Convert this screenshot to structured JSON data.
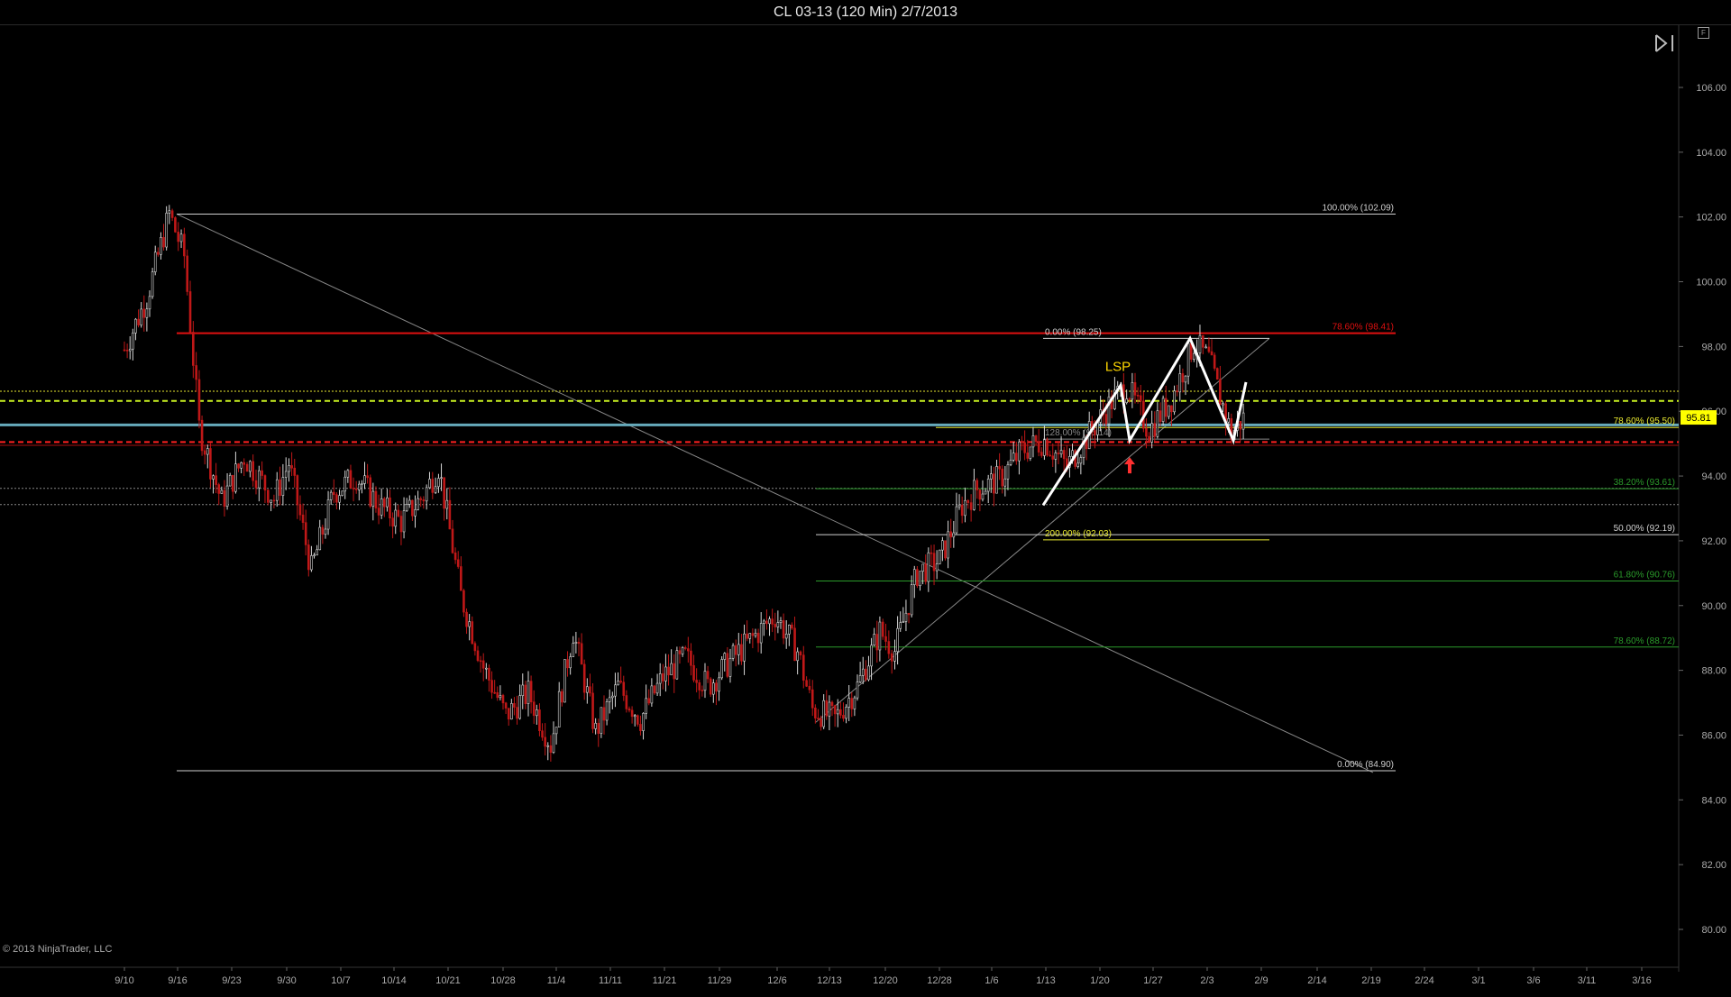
{
  "window": {
    "title": "CL 03-13 (120 Min)  2/7/2013",
    "copyright": "© 2013 NinjaTrader, LLC",
    "corner_button_label": "F"
  },
  "colors": {
    "background": "#000000",
    "up_bar": "#d8d8d8",
    "down_bar": "#c01818",
    "fib_red": "#e01010",
    "fib_green": "#2a9a2a",
    "fib_white": "#cfcfcf",
    "fib_yellow": "#e8e830",
    "price_marker_bg": "#ffff00",
    "lsp_label": "#ffd700",
    "arrow": "#ff3030"
  },
  "chart_data": {
    "type": "candlestick",
    "title": "CL 03-13 (120 Min)  2/7/2013",
    "ylim": [
      79.5,
      107.5
    ],
    "y_ticks": [
      "80.00",
      "82.00",
      "84.00",
      "86.00",
      "88.00",
      "90.00",
      "92.00",
      "94.00",
      "96.00",
      "98.00",
      "100.00",
      "102.00",
      "104.00",
      "106.00"
    ],
    "x_ticks": [
      "9/10",
      "9/16",
      "9/23",
      "9/30",
      "10/7",
      "10/14",
      "10/21",
      "10/28",
      "11/4",
      "11/11",
      "11/21",
      "11/29",
      "12/6",
      "12/13",
      "12/20",
      "12/28",
      "1/6",
      "1/13",
      "1/20",
      "1/27",
      "2/3",
      "2/9",
      "2/14",
      "2/19",
      "2/24",
      "3/1",
      "3/6",
      "3/11",
      "3/16"
    ],
    "last_price": "95.81",
    "price_path": [
      [
        9.1,
        97.9
      ],
      [
        9.13,
        99.5
      ],
      [
        9.16,
        102.1
      ],
      [
        9.18,
        100.8
      ],
      [
        9.2,
        95.5
      ],
      [
        9.23,
        93.2
      ],
      [
        9.26,
        94.6
      ],
      [
        9.3,
        93.3
      ],
      [
        10.02,
        94.4
      ],
      [
        10.05,
        91.1
      ],
      [
        10.08,
        93.5
      ],
      [
        10.11,
        94.0
      ],
      [
        10.14,
        93.1
      ],
      [
        10.17,
        92.6
      ],
      [
        10.2,
        93.4
      ],
      [
        10.22,
        94.3
      ],
      [
        10.25,
        90.3
      ],
      [
        10.28,
        88.1
      ],
      [
        10.31,
        86.6
      ],
      [
        11.03,
        87.3
      ],
      [
        11.06,
        85.7
      ],
      [
        11.09,
        89.2
      ],
      [
        11.12,
        86.1
      ],
      [
        11.15,
        87.5
      ],
      [
        11.18,
        86.5
      ],
      [
        11.21,
        87.8
      ],
      [
        11.24,
        88.4
      ],
      [
        11.27,
        87.5
      ],
      [
        11.3,
        88.3
      ],
      [
        12.03,
        89.0
      ],
      [
        12.06,
        89.7
      ],
      [
        12.09,
        88.6
      ],
      [
        12.11,
        86.8
      ],
      [
        12.14,
        86.5
      ],
      [
        12.17,
        87.5
      ],
      [
        12.2,
        89.2
      ],
      [
        12.22,
        88.6
      ],
      [
        12.25,
        91.0
      ],
      [
        12.28,
        91.4
      ],
      [
        12.31,
        93.1
      ],
      [
        13.02,
        93.6
      ],
      [
        13.05,
        93.9
      ],
      [
        13.08,
        94.8
      ],
      [
        13.11,
        95.1
      ],
      [
        13.14,
        94.3
      ],
      [
        13.17,
        95.3
      ],
      [
        13.2,
        96.3
      ],
      [
        13.22,
        96.8
      ],
      [
        13.25,
        95.4
      ],
      [
        13.28,
        96.4
      ],
      [
        13.31,
        98.1
      ],
      [
        14.02,
        97.6
      ],
      [
        14.05,
        95.3
      ],
      [
        14.07,
        95.9
      ]
    ],
    "horizontal_levels": [
      {
        "label": "100.00% (102.09)",
        "value": 102.09,
        "color": "white"
      },
      {
        "label": "78.60% (98.41)",
        "value": 98.41,
        "color": "red"
      },
      {
        "label": "0.00% (98.25)",
        "value": 98.25,
        "color": "white"
      },
      {
        "label": "78.60% (95.50)",
        "value": 95.5,
        "color": "yellow"
      },
      {
        "label": "38.20% (93.61)",
        "value": 93.61,
        "color": "green"
      },
      {
        "label": "50.00% (92.19)",
        "value": 92.19,
        "color": "white"
      },
      {
        "label": "200.00% (92.03)",
        "value": 92.03,
        "color": "yellow"
      },
      {
        "label": "61.80% (90.76)",
        "value": 90.76,
        "color": "green"
      },
      {
        "label": "78.60% (88.72)",
        "value": 88.72,
        "color": "green"
      },
      {
        "label": "0.00% (84.90)",
        "value": 84.9,
        "color": "white"
      },
      {
        "label": "128.00% (95.14)",
        "value": 95.14,
        "color": "gray"
      }
    ],
    "annotations": [
      "LSP"
    ],
    "grid": false
  }
}
